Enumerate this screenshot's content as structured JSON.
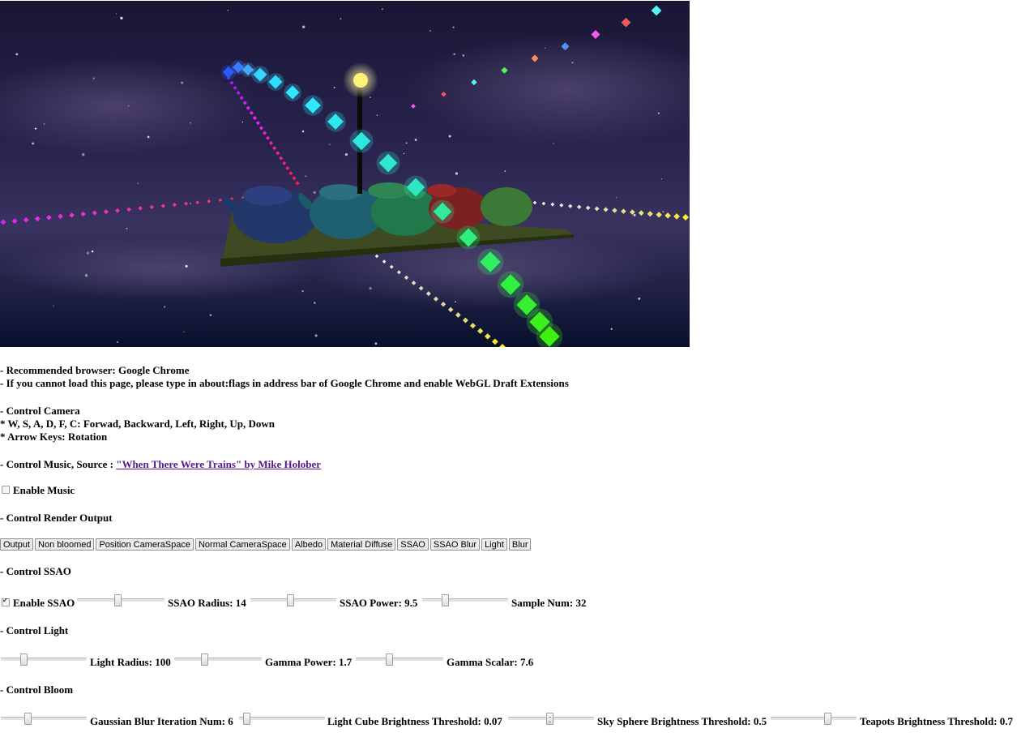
{
  "notes": {
    "browser": "- Recommended browser: Google Chrome",
    "flags": "- If you cannot load this page, please type in about:flags in address bar of Google Chrome and enable WebGL Draft Extensions"
  },
  "camera": {
    "heading": "- Control Camera",
    "keys": "* W, S, A, D, F, C: Forwad, Backward, Left, Right, Up, Down",
    "arrows": "* Arrow Keys: Rotation"
  },
  "music": {
    "heading": "- Control Music, Source :",
    "link_text": "\"When There Were Trains\" by Mike Holober",
    "enable_label": "Enable Music",
    "enabled": false
  },
  "render": {
    "heading": "- Control Render Output",
    "buttons": [
      "Output",
      "Non bloomed",
      "Position CameraSpace",
      "Normal CameraSpace",
      "Albedo",
      "Material Diffuse",
      "SSAO",
      "SSAO Blur",
      "Light",
      "Blur"
    ]
  },
  "ssao": {
    "heading": "- Control SSAO",
    "enable_label": "Enable SSAO",
    "enabled": true,
    "radius_label": "SSAO Radius: 14",
    "power_label": "SSAO Power: 9.5",
    "samples_label": "Sample Num: 32"
  },
  "light": {
    "heading": "- Control Light",
    "radius_label": "Light Radius: 100",
    "gamma_power_label": "Gamma Power: 1.7",
    "gamma_scalar_label": "Gamma Scalar: 7.6"
  },
  "bloom": {
    "heading": "- Control Bloom",
    "blur_iter_label": "Gaussian Blur Iteration Num: 6",
    "cube_thresh_label": "Light Cube Brightness Threshold: 0.07",
    "sky_thresh_label": "Sky Sphere Brightness Threshold: 0.5",
    "teapot_thresh_label": "Teapots Brightness Threshold: 0.7"
  },
  "sliders": {
    "ssao_radius": 0.46,
    "ssao_power": 0.46,
    "sample_num": 0.25,
    "light_radius": 0.25,
    "gamma_power": 0.33,
    "gamma_scalar": 0.37,
    "blur_iter": 0.3,
    "cube_thresh": 0.05,
    "sky_thresh": 0.48,
    "teapot_thresh": 0.68
  },
  "colors": {
    "sky_top": "#1a1838",
    "sky_bottom": "#0a1230",
    "link": "#551a8b"
  }
}
